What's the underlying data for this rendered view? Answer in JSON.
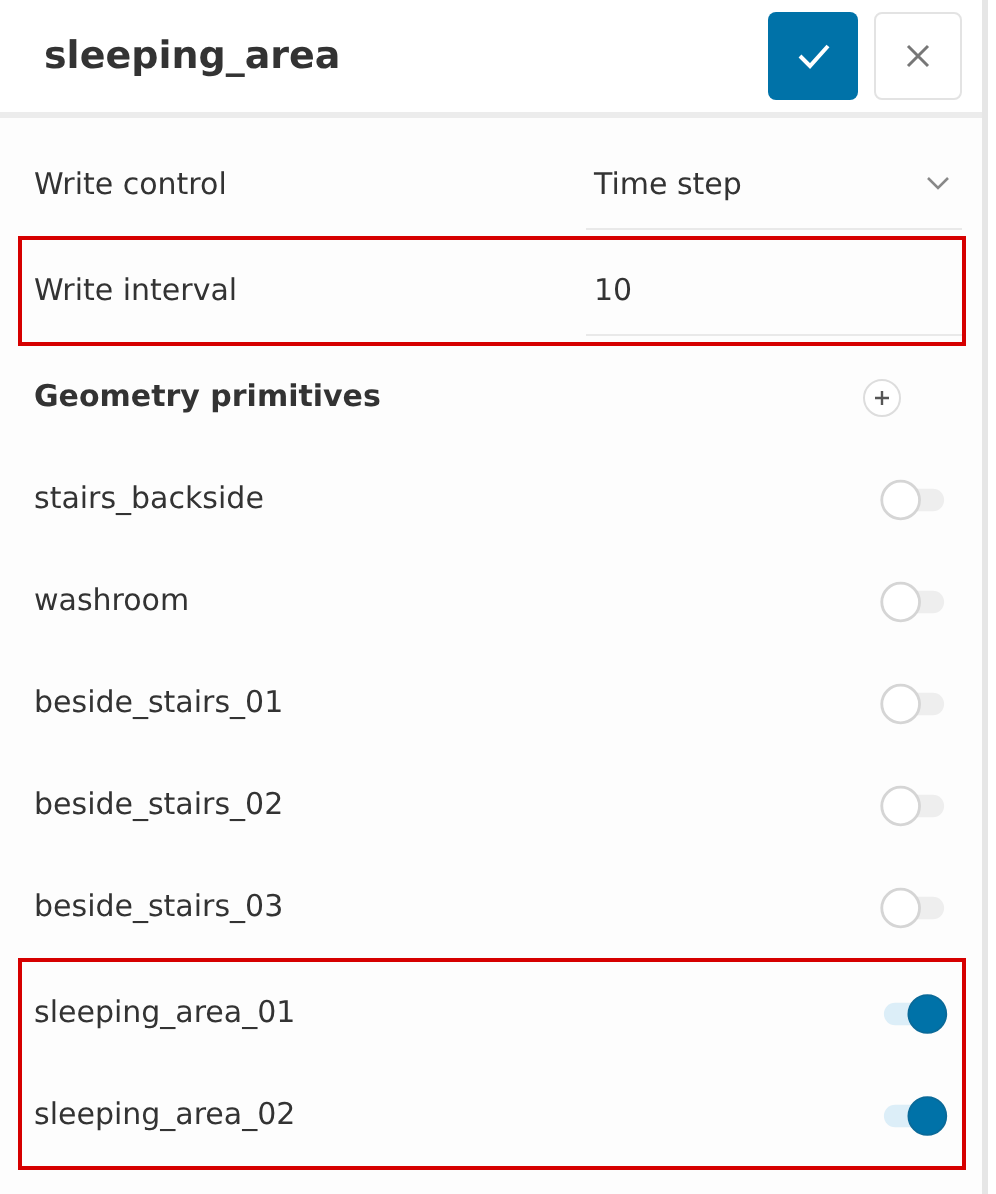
{
  "title": "sleeping_area",
  "fields": [
    {
      "label": "Write control",
      "value": "Time step",
      "kind": "select",
      "highlighted": false
    },
    {
      "label": "Write interval",
      "value": "10",
      "kind": "input",
      "highlighted": true
    }
  ],
  "section": {
    "title": "Geometry primitives"
  },
  "primitives": [
    {
      "name": "stairs_backside",
      "on": false,
      "highlighted": false
    },
    {
      "name": "washroom",
      "on": false,
      "highlighted": false
    },
    {
      "name": "beside_stairs_01",
      "on": false,
      "highlighted": false
    },
    {
      "name": "beside_stairs_02",
      "on": false,
      "highlighted": false
    },
    {
      "name": "beside_stairs_03",
      "on": false,
      "highlighted": false
    },
    {
      "name": "sleeping_area_01",
      "on": true,
      "highlighted": true
    },
    {
      "name": "sleeping_area_02",
      "on": true,
      "highlighted": true
    }
  ]
}
